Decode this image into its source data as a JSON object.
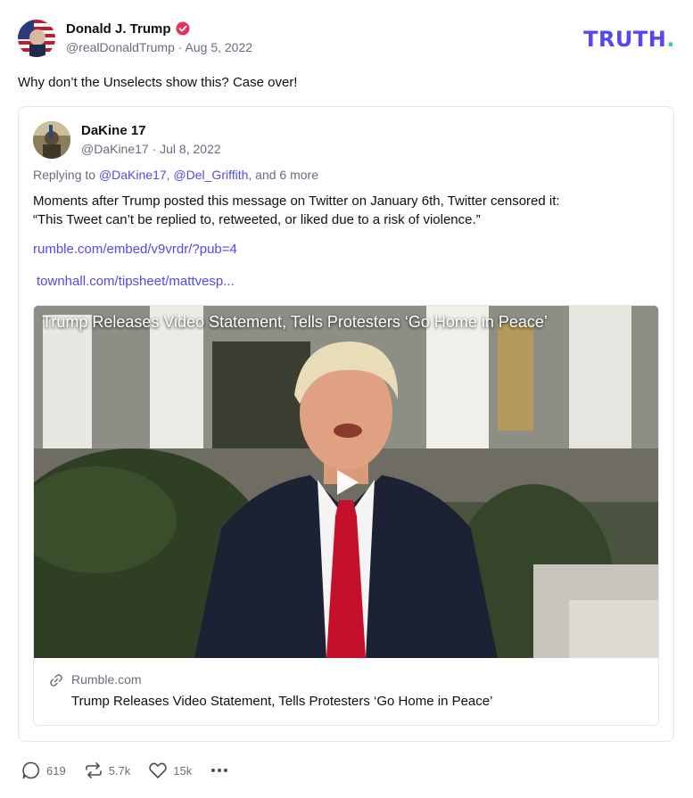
{
  "post": {
    "author_name": "Donald J. Trump",
    "handle_date": "@realDonaldTrump · Aug 5, 2022",
    "text": "Why don’t the Unselects show this? Case over!",
    "avatar_icon": "flag-avatar-icon",
    "verified_icon": "verified-badge-icon",
    "verified_color": "#e4325f"
  },
  "brand": {
    "logo_text": "TRUTH",
    "logo_dot": ".",
    "logo_color": "#5448ee",
    "dot_color": "#2cd5b6"
  },
  "quote": {
    "author_name": "DaKine 17",
    "handle_date": "@DaKine17 · Jul 8, 2022",
    "replying_prefix": "Replying to ",
    "mention1": "@DaKine17",
    "separator": ", ",
    "mention2": "@Del_Griffith",
    "replying_suffix": ", and 6 more",
    "body_line1": "Moments after Trump posted this message on Twitter on January 6th,  Twitter censored it:",
    "body_line2": "“This Tweet can’t be replied to, retweeted, or liked due to a risk of violence.”",
    "link1": "rumble.com/embed/v9vrdr/?pub=4",
    "link2": "townhall.com/tipsheet/mattvesp...",
    "embed": {
      "video_title": "Trump Releases Video Statement, Tells Protesters ‘Go Home in Peace’",
      "source": "Rumble.com",
      "title": "Trump Releases Video Statement, Tells Protesters ‘Go Home in Peace’",
      "play_icon": "play-icon",
      "link_icon": "link-icon"
    }
  },
  "actions": {
    "reply_count": "619",
    "retruth_count": "5.7k",
    "like_count": "15k",
    "icons": [
      "reply-icon",
      "retruth-icon",
      "like-icon",
      "more-icon"
    ]
  },
  "colors": {
    "accent": "#5448ee",
    "muted_text": "#6b6b7b",
    "border": "#e5e5ea"
  }
}
